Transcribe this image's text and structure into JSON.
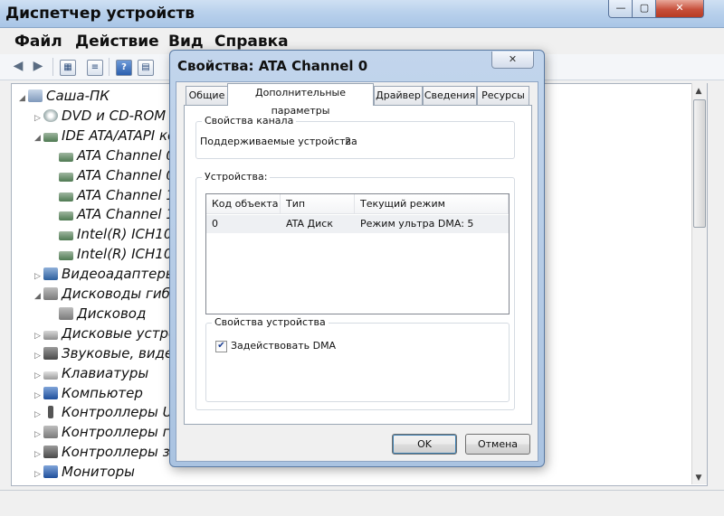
{
  "window": {
    "title": "Диспетчер устройств",
    "controls": {
      "minimize": "—",
      "maximize": "▢",
      "close": "✕"
    }
  },
  "menu": [
    "Файл",
    "Действие",
    "Вид",
    "Справка"
  ],
  "toolbar_icons": [
    "back-icon",
    "forward-icon",
    "properties-icon",
    "help-icon",
    "scan-icon",
    "update-driver-icon"
  ],
  "tree": [
    {
      "label": "Саша-ПК",
      "icon": "computer-icon",
      "level": 0,
      "expanded": true
    },
    {
      "label": "DVD и CD-ROM д",
      "icon": "dvd-icon",
      "level": 1,
      "expanded": false
    },
    {
      "label": "IDE ATA/ATAPI ко",
      "icon": "ide-controller-icon",
      "level": 1,
      "expanded": true
    },
    {
      "label": "ATA Channel 0",
      "icon": "ide-channel-icon",
      "level": 2
    },
    {
      "label": "ATA Channel 0",
      "icon": "ide-channel-icon",
      "level": 2
    },
    {
      "label": "ATA Channel 1",
      "icon": "ide-channel-icon",
      "level": 2
    },
    {
      "label": "ATA Channel 1",
      "icon": "ide-channel-icon",
      "level": 2
    },
    {
      "label": "Intel(R) ICH10",
      "icon": "ide-channel-icon",
      "level": 2
    },
    {
      "label": "Intel(R) ICH10",
      "icon": "ide-channel-icon",
      "level": 2
    },
    {
      "label": "Видеоадаптеры",
      "icon": "display-adapter-icon",
      "level": 1,
      "expanded": false
    },
    {
      "label": "Дисководы гибких",
      "icon": "floppy-drive-icon",
      "level": 1,
      "expanded": true
    },
    {
      "label": "Дисковод",
      "icon": "floppy-disk-icon",
      "level": 2
    },
    {
      "label": "Дисковые устройс",
      "icon": "disk-drive-icon",
      "level": 1,
      "expanded": false
    },
    {
      "label": "Звуковые, видео и",
      "icon": "sound-icon",
      "level": 1,
      "expanded": false
    },
    {
      "label": "Клавиатуры",
      "icon": "keyboard-icon",
      "level": 1,
      "expanded": false
    },
    {
      "label": "Компьютер",
      "icon": "computer-monitor-icon",
      "level": 1,
      "expanded": false
    },
    {
      "label": "Контроллеры USB",
      "icon": "usb-icon",
      "level": 1,
      "expanded": false
    },
    {
      "label": "Контроллеры гиб",
      "icon": "floppy-controller-icon",
      "level": 1,
      "expanded": false
    },
    {
      "label": "Контроллеры за",
      "icon": "storage-controller-icon",
      "level": 1,
      "expanded": false
    },
    {
      "label": "Мониторы",
      "icon": "monitor-icon",
      "level": 1,
      "expanded": false
    }
  ],
  "dialog": {
    "title": "Свойства: ATA Channel 0",
    "close": "✕",
    "tabs": [
      "Общие",
      "Дополнительные параметры",
      "Драйвер",
      "Сведения",
      "Ресурсы"
    ],
    "active_tab": 1,
    "channel_group": {
      "title": "Свойства канала",
      "supported_label": "Поддерживаемые устройства",
      "supported_value": "2"
    },
    "devices_group": {
      "title": "Устройства:",
      "columns": [
        "Код объекта",
        "Тип устройс...",
        "Текущий режим"
      ],
      "rows": [
        [
          "0",
          "ATA Диск",
          "Режим ультра DMA: 5"
        ]
      ]
    },
    "device_props_group": {
      "title": "Свойства устройства",
      "checkbox_label": "Задействовать DMA",
      "checked": true
    },
    "ok": "OK",
    "cancel": "Отмена"
  }
}
